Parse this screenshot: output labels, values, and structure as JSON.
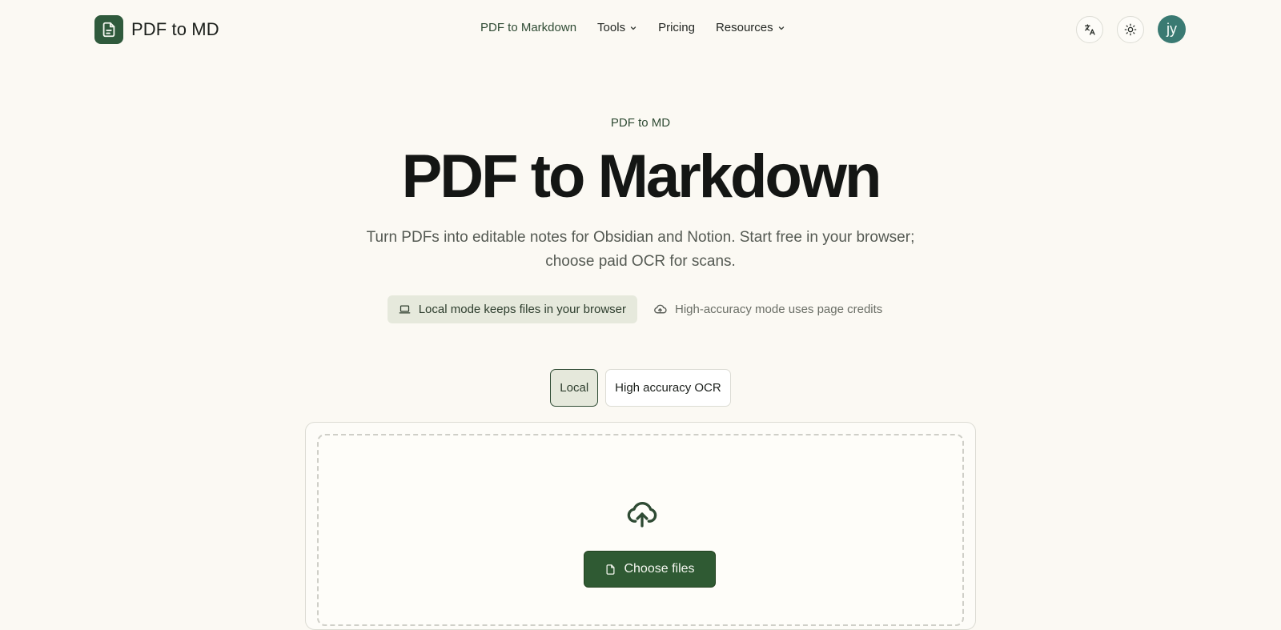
{
  "header": {
    "brand": "PDF to MD",
    "nav": [
      {
        "label": "PDF to Markdown",
        "has_dropdown": false,
        "active": true
      },
      {
        "label": "Tools",
        "has_dropdown": true
      },
      {
        "label": "Pricing",
        "has_dropdown": false
      },
      {
        "label": "Resources",
        "has_dropdown": true
      }
    ],
    "actions": {
      "language_icon": "translate-icon",
      "theme_icon": "sun-icon",
      "avatar_initials": "jy"
    }
  },
  "hero": {
    "eyebrow": "PDF to MD",
    "title": "PDF to Markdown",
    "subtitle": "Turn PDFs into editable notes for Obsidian and Notion. Start free in your browser; choose paid OCR for scans."
  },
  "features": {
    "local_mode": {
      "icon": "laptop-icon",
      "label": "Local mode keeps files in your browser"
    },
    "high_accuracy": {
      "icon": "cloud-icon",
      "label": "High-accuracy mode uses page credits"
    }
  },
  "mode_toggle": {
    "selected": "Local",
    "options": [
      "Local",
      "High accuracy OCR"
    ]
  },
  "upload": {
    "icon": "cloud-upload-icon",
    "button_label": "Choose files",
    "button_icon": "file-icon"
  },
  "colors": {
    "background": "#fbf9f3",
    "brand_green": "#2f5a3c",
    "button_green": "#2f5a33",
    "avatar_teal": "#3a7a72"
  }
}
